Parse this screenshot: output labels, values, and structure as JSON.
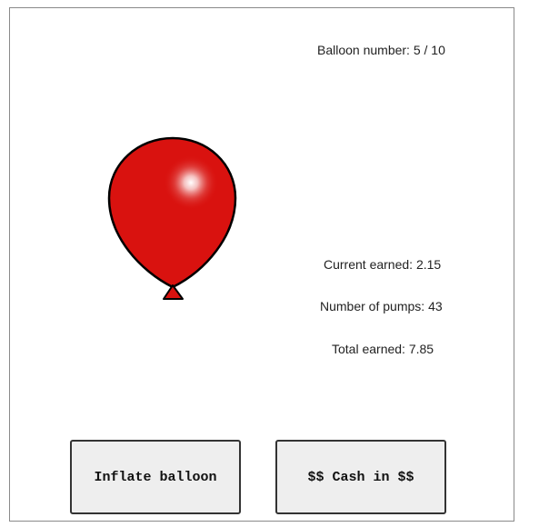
{
  "game": {
    "balloon_label": "Balloon number:",
    "balloon_value": "5 / 10",
    "current_earned_label": "Current earned:",
    "current_earned_value": "2.15",
    "pumps_label": "Number of pumps:",
    "pumps_value": "43",
    "total_earned_label": "Total earned:",
    "total_earned_value": "7.85"
  },
  "controls": {
    "inflate_label": "Inflate balloon",
    "cash_in_label": "$$ Cash in $$"
  },
  "balloon": {
    "color": "#d9120f",
    "icon": "balloon-icon"
  }
}
